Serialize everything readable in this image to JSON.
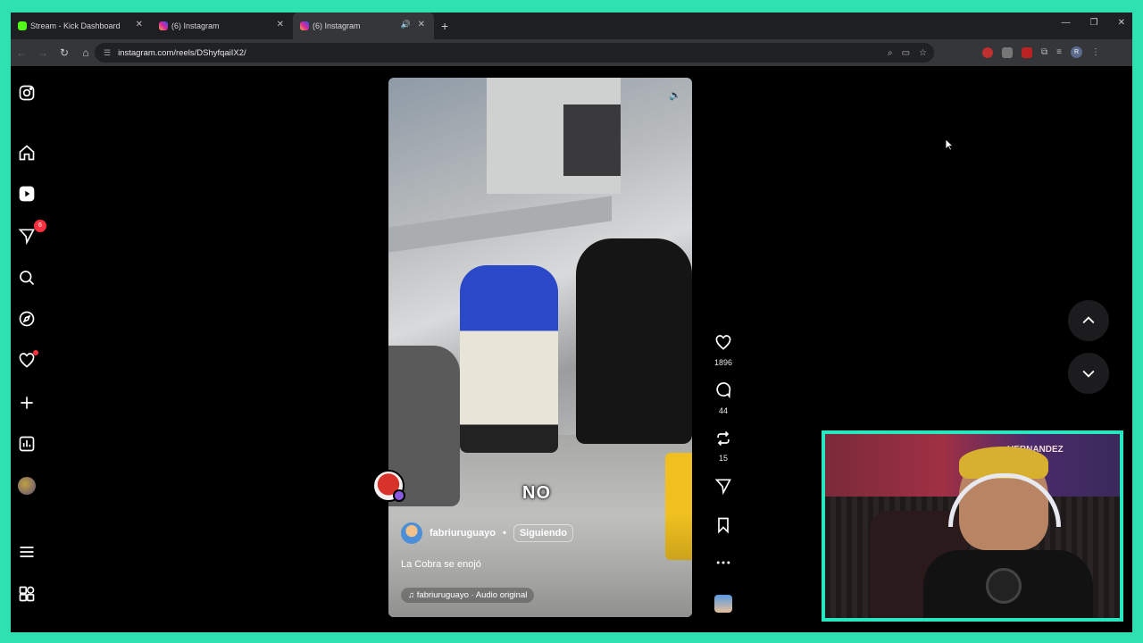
{
  "browser": {
    "tabs": [
      {
        "label": "Stream - Kick Dashboard",
        "active": false
      },
      {
        "label": "(6) Instagram",
        "active": false
      },
      {
        "label": "(6) Instagram",
        "active": true
      }
    ],
    "url": "instagram.com/reels/DShyfqaiIX2/",
    "new_tab_label": "+"
  },
  "sidebar": {
    "notifications_badge": "6"
  },
  "reel": {
    "caption_overlay": "NO",
    "username": "fabriuruguayo",
    "separator": "•",
    "follow_label": "Siguiendo",
    "description": "La Cobra se enojó",
    "audio": "fabriuruguayo · Audio original"
  },
  "actions": {
    "likes": "1896",
    "comments": "44",
    "reposts": "15"
  },
  "webcam": {
    "poster_text": "HERNANDEZ"
  },
  "colors": {
    "frame_accent": "#2fe0b0",
    "webcam_border": "#28e6c0",
    "notification_red": "#ff3040"
  }
}
